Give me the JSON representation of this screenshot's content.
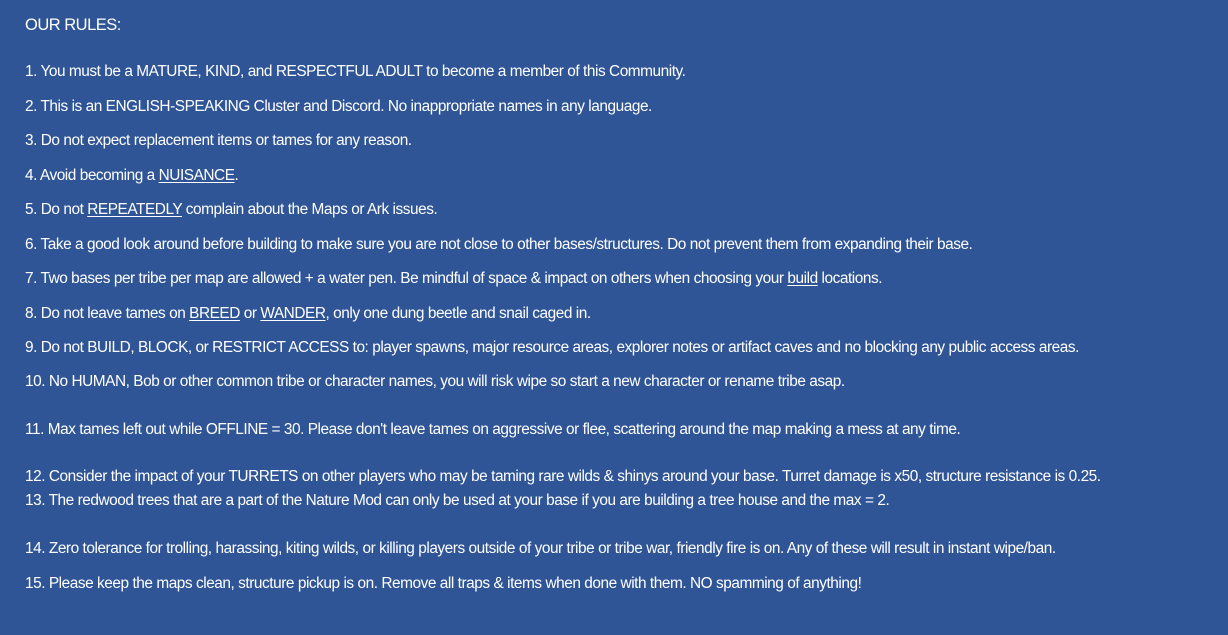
{
  "heading": "OUR RULES:",
  "rules": {
    "r1": "1. You must be a MATURE, KIND, and RESPECTFUL ADULT to become a member of this Community.",
    "r2": "2. This is an ENGLISH-SPEAKING Cluster and Discord. No inappropriate names in any language.",
    "r3": "3. Do not expect replacement items or tames for any reason.",
    "r4_pre": "4. Avoid becoming a ",
    "r4_u": "NUISANCE",
    "r4_post": ".",
    "r5_pre": "5. Do not ",
    "r5_u": "REPEATEDLY",
    "r5_post": " complain about the Maps or Ark issues.",
    "r6": "6. Take a good look around before building to make sure you are not close to other bases/structures. Do not prevent them from expanding their base.",
    "r7_pre": "7. Two bases per tribe per map are allowed + a water pen. Be mindful of space & impact on others when choosing your ",
    "r7_u": "build",
    "r7_post": " locations.",
    "r8_pre": "8. Do not leave tames on ",
    "r8_u1": "BREED",
    "r8_mid": " or ",
    "r8_u2": "WANDER",
    "r8_post": ", only one dung beetle and snail caged in.",
    "r9": "9. Do not BUILD, BLOCK, or RESTRICT ACCESS to: player spawns, major resource areas, explorer notes or artifact caves and no blocking any public access areas.",
    "r10": "10. No HUMAN, Bob or other common tribe or character names, you will risk wipe so start a new character or rename tribe asap.",
    "r11": "11. Max tames left out while OFFLINE = 30. Please don't leave tames on aggressive or flee, scattering around the map making a mess at any time.",
    "r12": "12. Consider the impact of your TURRETS on other players who may be taming rare wilds & shinys around your base. Turret damage is x50, structure resistance is 0.25.",
    "r13": "13. The redwood trees that are a part of the Nature Mod can only be used at your base if you are building a tree house and the max = 2.",
    "r14": "14. Zero tolerance for trolling, harassing, kiting wilds, or killing players outside of your tribe or tribe war, friendly fire is on. Any of these will result in instant wipe/ban.",
    "r15": "15. Please keep the maps clean, structure pickup is on. Remove all traps & items when done with them. NO spamming of anything!"
  },
  "colors": {
    "background": "#2f5597",
    "text": "#ffffff"
  }
}
